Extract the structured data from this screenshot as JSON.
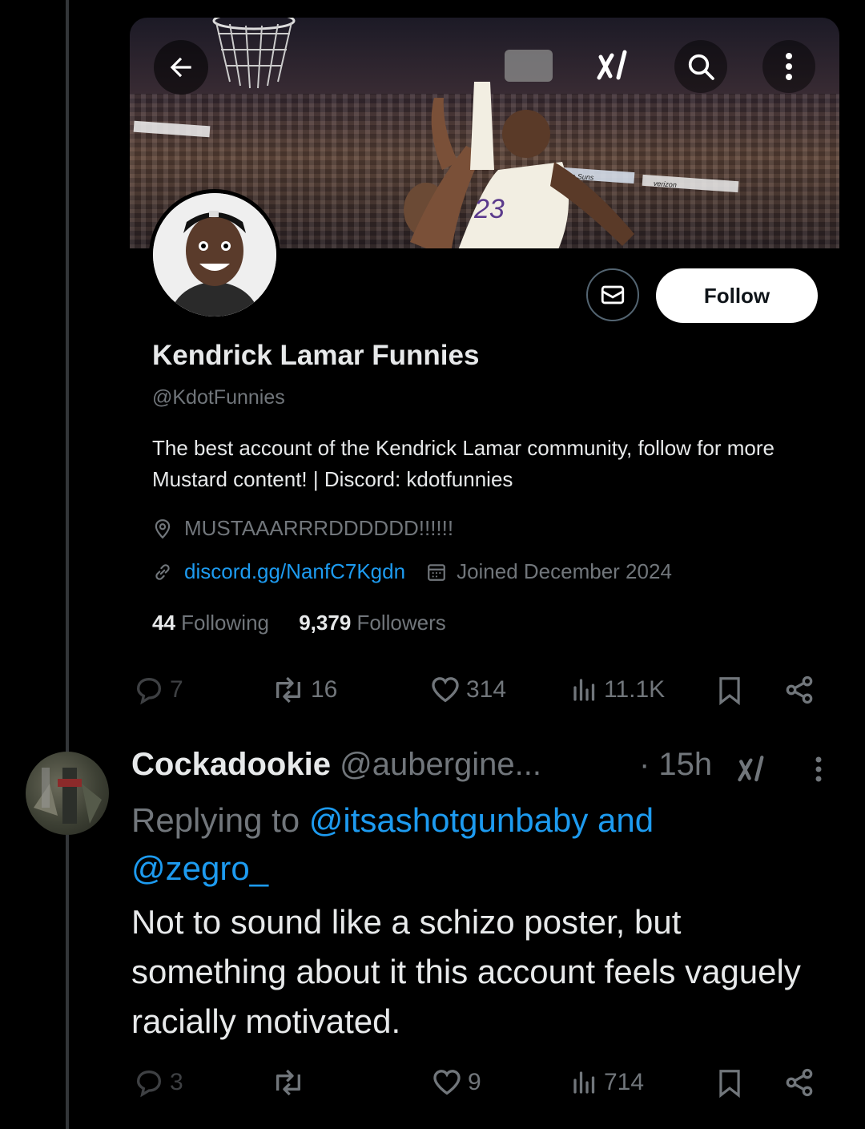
{
  "profile_card": {
    "name": "Kendrick Lamar Funnies",
    "handle": "@KdotFunnies",
    "bio": "The best account of the Kendrick Lamar community, follow for more Mustard content! | Discord: kdotfunnies",
    "location": "MUSTAAARRRDDDDDD!!!!!!",
    "website": "discord.gg/NanfC7Kgdn",
    "joined": "Joined December 2024",
    "following_count": "44",
    "following_label": "Following",
    "followers_count": "9,379",
    "followers_label": "Followers",
    "follow_button": "Follow",
    "banner_signs": [
      "the Suns",
      "verizon"
    ],
    "jersey_number": "23"
  },
  "parent_post_actions": {
    "replies": "7",
    "reposts": "16",
    "likes": "314",
    "views": "11.1K"
  },
  "reply": {
    "author_name": "Cockadookie",
    "author_handle": "@aubergine...",
    "time": "· 15h",
    "replying_prefix": "Replying to",
    "replying_mentions_1": "@itsashotgunbaby and",
    "replying_mentions_2": "@zegro_",
    "text": "Not to sound like a schizo poster, but something about it this account feels vaguely racially motivated.",
    "actions": {
      "replies": "3",
      "reposts": "",
      "likes": "9",
      "views": "714"
    }
  },
  "colors": {
    "background": "#000000",
    "text_primary": "#e7e9ea",
    "text_secondary": "#71767b",
    "link": "#1d9bf0"
  }
}
